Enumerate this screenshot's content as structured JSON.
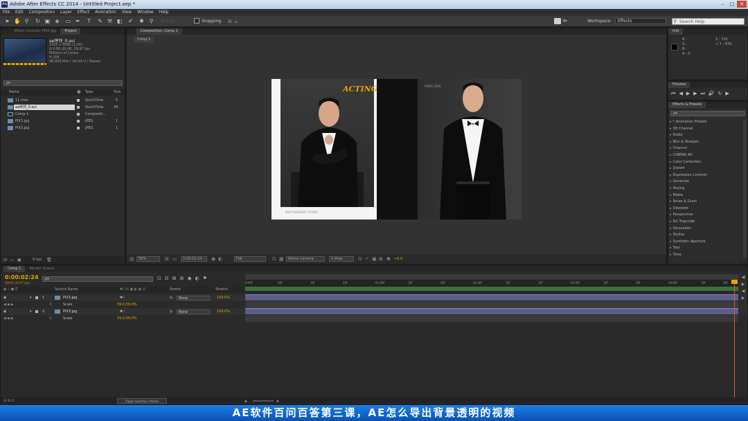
{
  "window": {
    "title": "Adobe After Effects CC 2014 - Untitled Project.aep *",
    "minimize": "–",
    "maximize": "□",
    "close": "✕"
  },
  "menu": [
    "File",
    "Edit",
    "Composition",
    "Layer",
    "Effect",
    "Animation",
    "View",
    "Window",
    "Help"
  ],
  "toolbar": {
    "snapping": "Snapping",
    "workspace_label": "Workspace:",
    "workspace_value": "Effects",
    "search_placeholder": "Search Help"
  },
  "project": {
    "tabs": [
      "Effect Controls: PIX3.jpg",
      "Project"
    ],
    "thumb": {
      "name": "ae序列_0.avi",
      "info": [
        "1920 x 1080 (1.00)",
        "Δ 0:00:20:06, 29.97 fps",
        "Millions of Colors",
        "H.264",
        "48,000 kHz / 16 bit U / Stereo"
      ]
    },
    "search_placeholder": "ρ▾",
    "columns": {
      "name": "Name",
      "type": "Type",
      "size": "Size"
    },
    "items": [
      {
        "name": "11.mov",
        "type": "QuickTime",
        "size": "5"
      },
      {
        "name": "ae序列_0.avi",
        "type": "QuickTime",
        "size": "29"
      },
      {
        "name": "Comp 1",
        "type": "Compositi...",
        "size": ""
      },
      {
        "name": "PIX3.jpg",
        "type": "JPEG",
        "size": "1"
      },
      {
        "name": "PIX3.jpg",
        "type": "JPEG",
        "size": "1"
      }
    ],
    "bpc": "8 bpc"
  },
  "composition": {
    "tab": "Composition: Comp 1",
    "comp_tab": "Comp 1",
    "zoom": "50%",
    "timecode": "0:00:02:24",
    "resolution": "Full",
    "camera": "Active Camera",
    "view": "1 View",
    "exposure": "+0.0",
    "photo": {
      "logo": "ACTING",
      "small_caption": "PHOTOGRAPHY STUDIO",
      "right_caption": "SINCE 2000"
    }
  },
  "info": {
    "tab": "Info",
    "r": "R :",
    "g": "G :",
    "b": "B :",
    "a": "A : 0",
    "x": "X : 702",
    "y": "+ Y : 679"
  },
  "preview": {
    "tab": "Preview"
  },
  "effects": {
    "tab": "Effects & Presets",
    "search_placeholder": "ρ▾",
    "categories": [
      "* Animation Presets",
      "3D Channel",
      "Audio",
      "Blur & Sharpen",
      "Channel",
      "CINEMA 4D",
      "Color Correction",
      "Distort",
      "Expression Controls",
      "Generate",
      "Keying",
      "Matte",
      "Noise & Grain",
      "Obsolete",
      "Perspective",
      "RG Trapcode",
      "Simulation",
      "Stylize",
      "Synthetic Aperture",
      "Text",
      "Time"
    ]
  },
  "timeline": {
    "tabs": [
      "Comp 1",
      "Render Queue"
    ],
    "timecode": "0:00:02:24",
    "frames": "00074 (29.97 fps)",
    "search_placeholder": "ρ▾",
    "columns": {
      "source": "Source Name",
      "parent": "Parent",
      "stretch": "Stretch"
    },
    "layers": [
      {
        "num": "1",
        "name": "PIX3.jpg",
        "parent": "None",
        "stretch": "100.0%",
        "prop": "Scale",
        "value": "59.0,59.0%"
      },
      {
        "num": "2",
        "name": "PIX3.jpg",
        "parent": "None",
        "stretch": "100.0%",
        "prop": "Scale",
        "value": "59.0,59.0%"
      }
    ],
    "ruler": [
      "0:00f",
      "00f",
      "10f",
      "20f",
      "01:00f",
      "10f",
      "20f",
      "02:00f",
      "10f",
      "20f",
      "03:00f",
      "10f",
      "20f",
      "04:00f",
      "10f",
      "20f"
    ],
    "toggle": "Toggle Switches / Modes"
  },
  "subtitle": "AE软件百问百答第三课，AE怎么导出背景透明的视频",
  "colors": {
    "accent": "#e8a400",
    "subtitle_bg": "#1470d6",
    "layer_bar": "#5c5c8a"
  }
}
